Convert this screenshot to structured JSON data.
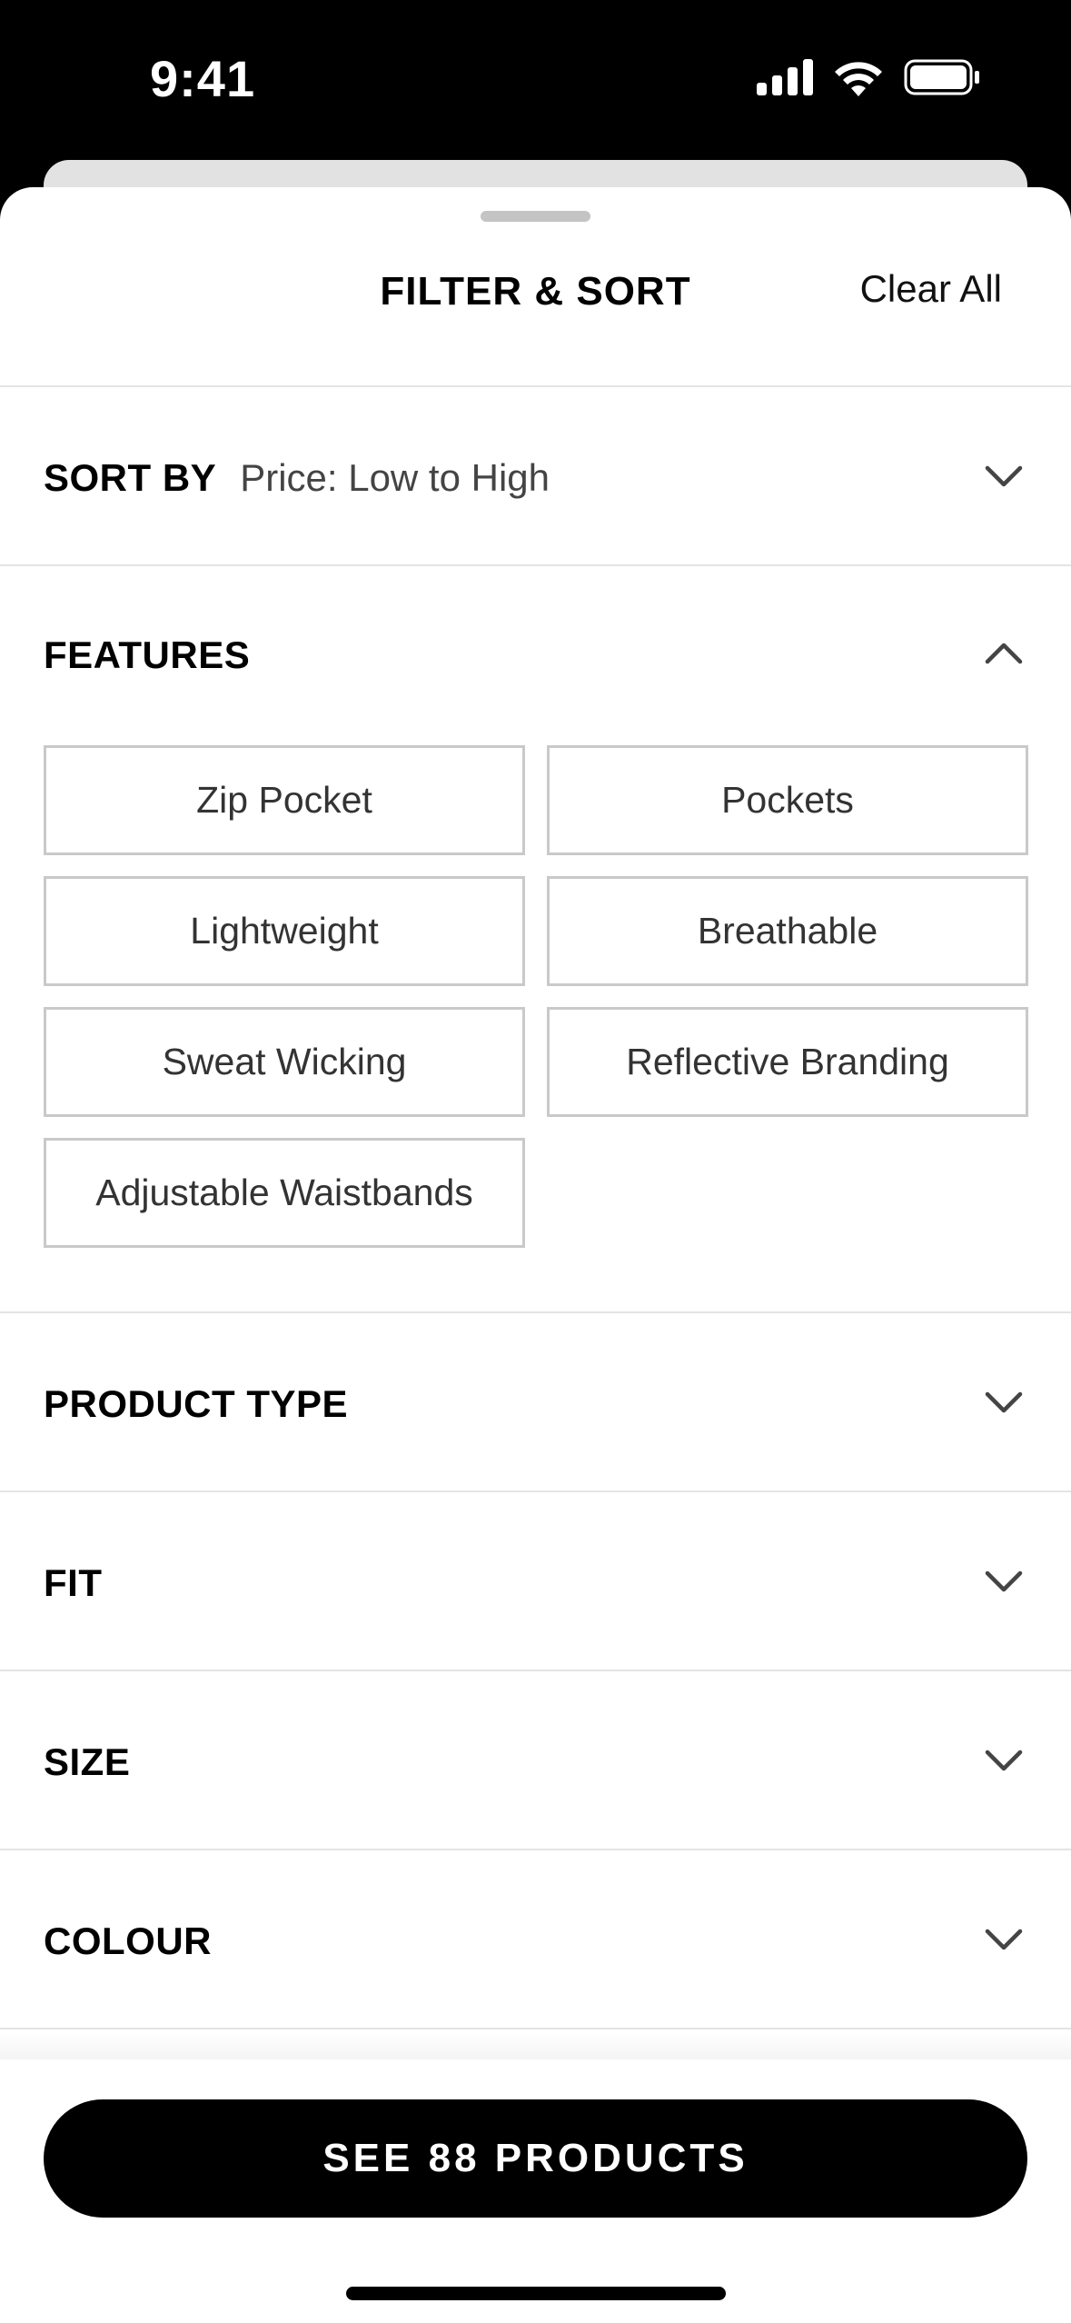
{
  "status_bar": {
    "time": "9:41"
  },
  "header": {
    "title": "FILTER & SORT",
    "clear_all": "Clear All"
  },
  "sort": {
    "label": "SORT BY",
    "value": "Price: Low to High"
  },
  "features": {
    "label": "FEATURES",
    "options": [
      "Zip Pocket",
      "Pockets",
      "Lightweight",
      "Breathable",
      "Sweat Wicking",
      "Reflective Branding",
      "Adjustable Waistbands"
    ]
  },
  "sections": {
    "product_type": "PRODUCT TYPE",
    "fit": "FIT",
    "size": "SIZE",
    "colour": "COLOUR"
  },
  "footer": {
    "button_label": "SEE 88 PRODUCTS"
  }
}
